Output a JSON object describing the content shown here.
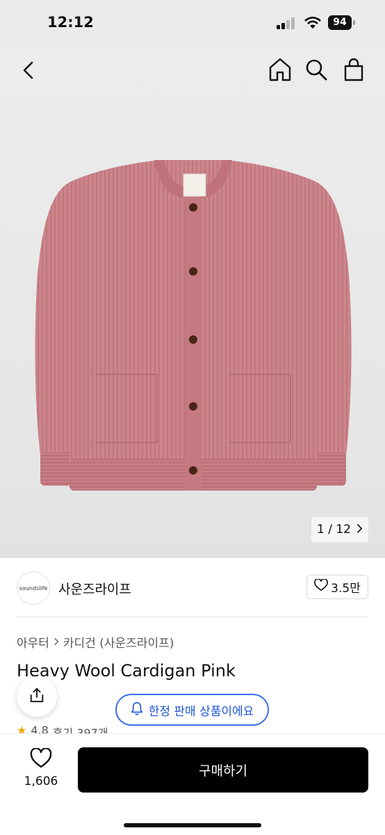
{
  "status": {
    "time": "12:12",
    "battery": "94"
  },
  "nav": {
    "back_icon": "chevron-left-icon",
    "home_icon": "home-icon",
    "search_icon": "search-icon",
    "bag_icon": "shopping-bag-icon"
  },
  "gallery": {
    "pager": "1 / 12"
  },
  "seller": {
    "logo_text": "soundslife",
    "name": "사운즈라이프",
    "likes": "3.5만"
  },
  "breadcrumb": {
    "category": "아우터",
    "subcategory": "카디건 (사운즈라이프)"
  },
  "product": {
    "title": "Heavy Wool Cardigan Pink",
    "rating": "4.8",
    "reviews": "후기 397개"
  },
  "badge": {
    "label": "한정 판매 상품이에요"
  },
  "bottom_bar": {
    "wish_count": "1,606",
    "buy_label": "구매하기"
  },
  "colors": {
    "accent_blue": "#1f55d6",
    "cardigan_pink": "#c98288",
    "buy_button": "#000000"
  }
}
